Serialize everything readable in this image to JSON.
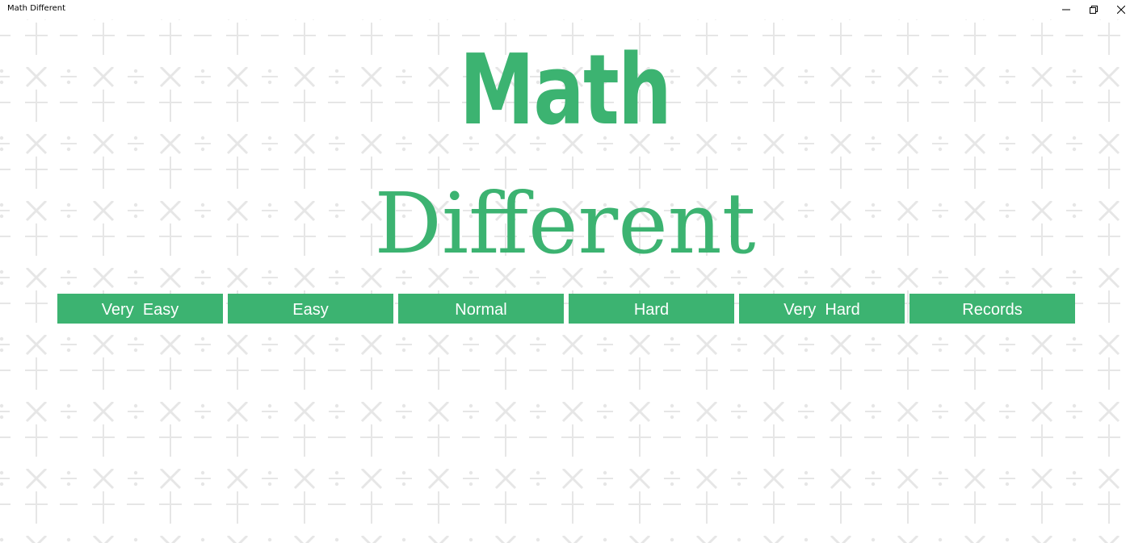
{
  "window": {
    "title": "Math Different",
    "controls": {
      "minimize_icon": "minimize-icon",
      "maximize_icon": "restore-icon",
      "close_icon": "close-icon"
    }
  },
  "logo": {
    "line1": "Math",
    "line2": "Different",
    "color": "#3cb371"
  },
  "background_pattern": {
    "symbols": [
      "×",
      "÷",
      "+",
      "−"
    ],
    "color": "#e6e6e6"
  },
  "menu": {
    "buttons": [
      {
        "label": "Very  Easy"
      },
      {
        "label": "Easy"
      },
      {
        "label": "Normal"
      },
      {
        "label": "Hard"
      },
      {
        "label": "Very  Hard"
      },
      {
        "label": "Records"
      }
    ],
    "button_color": "#3cb371",
    "text_color": "#ffffff"
  }
}
